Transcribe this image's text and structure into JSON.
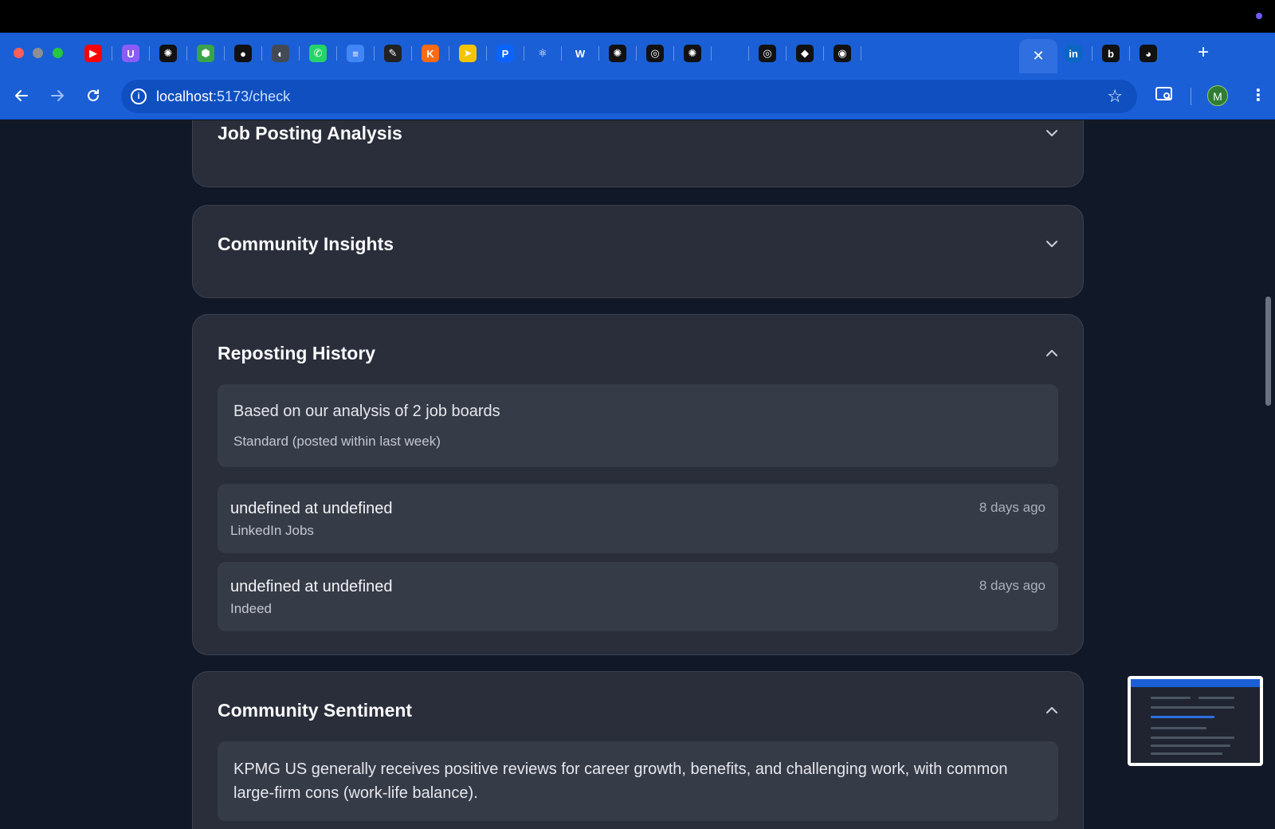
{
  "browser": {
    "url_host": "localhost",
    "url_path": ":5173/check",
    "avatar_letter": "M",
    "active_tab_close": "✕",
    "new_tab": "+",
    "tab_favicons": [
      {
        "name": "youtube",
        "glyph": "▶",
        "color": "#ff0000"
      },
      {
        "name": "ublock",
        "glyph": "U",
        "color": "#8b5cf6"
      },
      {
        "name": "openai",
        "glyph": "✺",
        "color": "#111111"
      },
      {
        "name": "hexagon",
        "glyph": "⬢",
        "color": "#3aa44a"
      },
      {
        "name": "github",
        "glyph": "●",
        "color": "#111111"
      },
      {
        "name": "globe",
        "glyph": "◐",
        "color": "#444a55"
      },
      {
        "name": "whatsapp",
        "glyph": "✆",
        "color": "#25d366"
      },
      {
        "name": "docs",
        "glyph": "≡",
        "color": "#4285f4"
      },
      {
        "name": "cursor",
        "glyph": "✎",
        "color": "#222222"
      },
      {
        "name": "k-app",
        "glyph": "K",
        "color": "#ff6a13"
      },
      {
        "name": "arrow-app",
        "glyph": "➤",
        "color": "#f5c400"
      },
      {
        "name": "p-app",
        "glyph": "P",
        "color": "#0b63ff"
      },
      {
        "name": "react",
        "glyph": "⚛",
        "color": "#1a5fd6"
      },
      {
        "name": "w-app",
        "glyph": "W",
        "color": "#1a5fd6"
      },
      {
        "name": "ai-app-1",
        "glyph": "✺",
        "color": "#111111"
      },
      {
        "name": "ai-app-2",
        "glyph": "◎",
        "color": "#111111"
      },
      {
        "name": "ai-app-3",
        "glyph": "✺",
        "color": "#111111"
      },
      {
        "name": "blank",
        "glyph": "",
        "color": "#1a5fd6"
      },
      {
        "name": "ai-app-4",
        "glyph": "◎",
        "color": "#111111"
      },
      {
        "name": "cursor-app",
        "glyph": "◆",
        "color": "#111111"
      },
      {
        "name": "chrome-app",
        "glyph": "◉",
        "color": "#111111"
      }
    ],
    "tabs_after": [
      {
        "name": "linkedin",
        "glyph": "in",
        "color": "#0a66c2"
      },
      {
        "name": "b-app",
        "glyph": "b",
        "color": "#111111"
      },
      {
        "name": "z-app",
        "glyph": "◕",
        "color": "#111111"
      }
    ]
  },
  "sections": {
    "job_posting": {
      "title": "Job Posting Analysis"
    },
    "community_insights": {
      "title": "Community Insights"
    },
    "reposting_history": {
      "title": "Reposting History",
      "summary_headline": "Based on our analysis of 2 job boards",
      "summary_sub": "Standard (posted within last week)",
      "postings": [
        {
          "title": "undefined at undefined",
          "board": "LinkedIn Jobs",
          "date": "8 days ago"
        },
        {
          "title": "undefined at undefined",
          "board": "Indeed",
          "date": "8 days ago"
        }
      ]
    },
    "community_sentiment": {
      "title": "Community Sentiment",
      "text": "KPMG US generally receives positive reviews for career growth, benefits, and challenging work, with common large-firm cons (work-life balance)."
    }
  }
}
